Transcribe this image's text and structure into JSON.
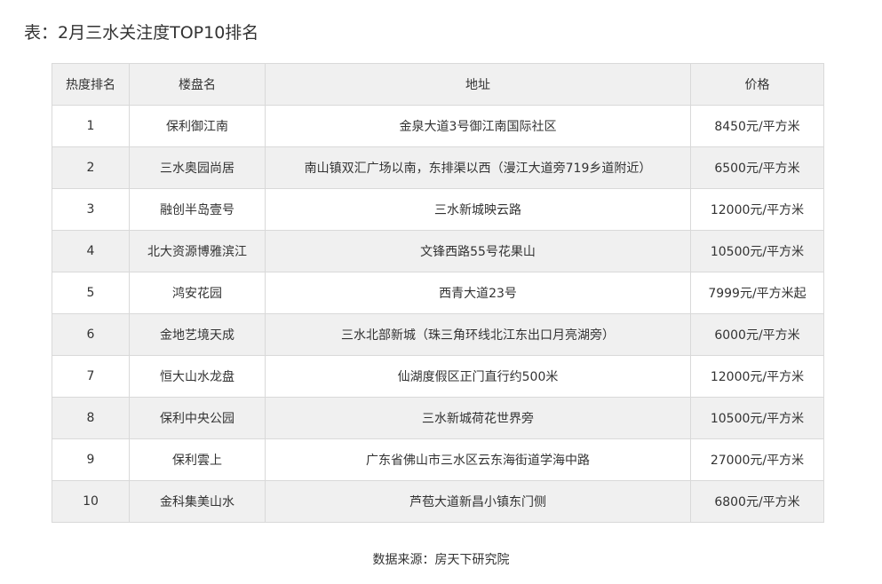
{
  "caption": "表：2月三水关注度TOP10排名",
  "table": {
    "headers": {
      "rank": "热度排名",
      "name": "楼盘名",
      "address": "地址",
      "price": "价格"
    },
    "rows": [
      {
        "rank": "1",
        "name": "保利御江南",
        "address": "金泉大道3号御江南国际社区",
        "price": "8450元/平方米"
      },
      {
        "rank": "2",
        "name": "三水奥园尚居",
        "address": "南山镇双汇广场以南，东排渠以西（漫江大道旁719乡道附近）",
        "price": "6500元/平方米"
      },
      {
        "rank": "3",
        "name": "融创半岛壹号",
        "address": "三水新城映云路",
        "price": "12000元/平方米"
      },
      {
        "rank": "4",
        "name": "北大资源博雅滨江",
        "address": "文锋西路55号花果山",
        "price": "10500元/平方米"
      },
      {
        "rank": "5",
        "name": "鸿安花园",
        "address": "西青大道23号",
        "price": "7999元/平方米起"
      },
      {
        "rank": "6",
        "name": "金地艺境天成",
        "address": "三水北部新城（珠三角环线北江东出口月亮湖旁）",
        "price": "6000元/平方米"
      },
      {
        "rank": "7",
        "name": "恒大山水龙盘",
        "address": "仙湖度假区正门直行约500米",
        "price": "12000元/平方米"
      },
      {
        "rank": "8",
        "name": "保利中央公园",
        "address": "三水新城荷花世界旁",
        "price": "10500元/平方米"
      },
      {
        "rank": "9",
        "name": "保利雲上",
        "address": "广东省佛山市三水区云东海街道学海中路",
        "price": "27000元/平方米"
      },
      {
        "rank": "10",
        "name": "金科集美山水",
        "address": "芦苞大道新昌小镇东门侧",
        "price": "6800元/平方米"
      }
    ]
  },
  "source": "数据来源：房天下研究院"
}
